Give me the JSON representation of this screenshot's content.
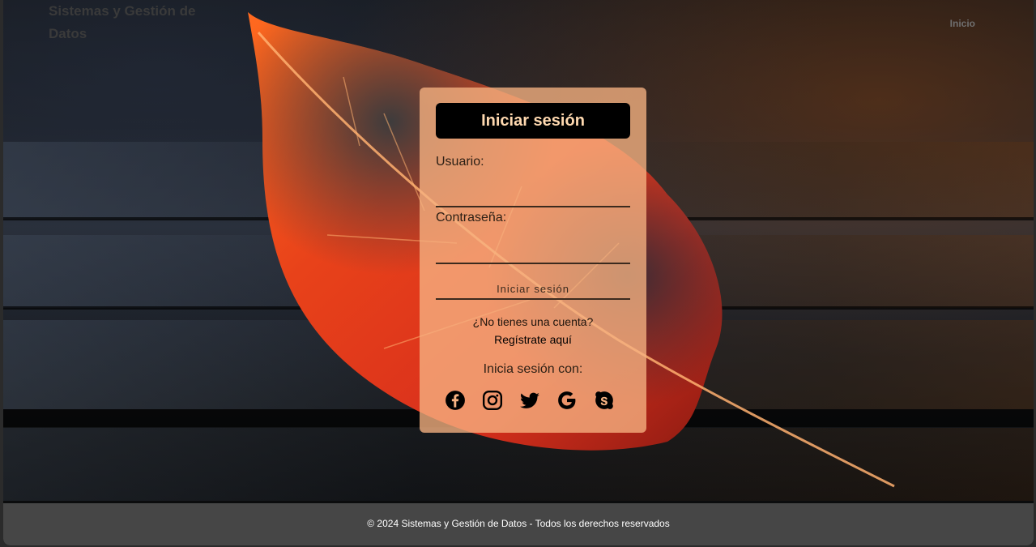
{
  "header": {
    "site_title": "Sistemas y Gestión de Datos",
    "nav": {
      "home_label": "Inicio"
    }
  },
  "login": {
    "title": "Iniciar sesión",
    "username_label": "Usuario:",
    "username_value": "",
    "password_label": "Contraseña:",
    "password_value": "",
    "submit_label": "Iniciar sesión",
    "no_account_text": "¿No tienes una cuenta?",
    "register_link": "Regístrate aquí",
    "social_label": "Inicia sesión con:",
    "social_icons": [
      "facebook-icon",
      "instagram-icon",
      "twitter-icon",
      "google-icon",
      "skype-icon"
    ]
  },
  "footer": {
    "copyright": "© 2024 Sistemas y Gestión de Datos - Todos los derechos reservados"
  },
  "colors": {
    "card_background": "#f6b282",
    "header_button": "#000000",
    "header_text": "#ffd9b0",
    "footer_background": "#464646"
  }
}
